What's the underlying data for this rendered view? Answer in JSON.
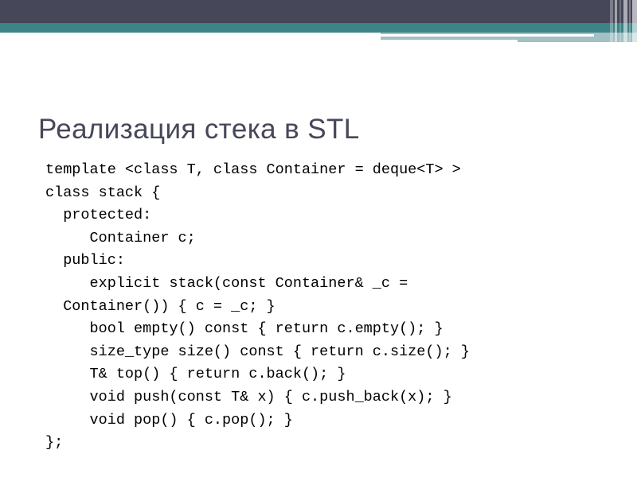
{
  "slide": {
    "title": "Реализация стека в STL",
    "theme": {
      "dark_band": "#464759",
      "teal_band": "#3d8486",
      "light_band": "#a3c0c4",
      "background": "#ffffff",
      "title_color": "#464759",
      "code_color": "#000000"
    },
    "code_lines": [
      "template <class T, class Container = deque<T> >",
      "class stack {",
      "  protected:",
      "     Container c;",
      "  public:",
      "     explicit stack(const Container& _c =",
      "  Container()) { c = _c; }",
      "     bool empty() const { return c.empty(); }",
      "     size_type size() const { return c.size(); }",
      "     T& top() { return c.back(); }",
      "     void push(const T& x) { c.push_back(x); }",
      "     void pop() { c.pop(); }",
      "};"
    ]
  }
}
